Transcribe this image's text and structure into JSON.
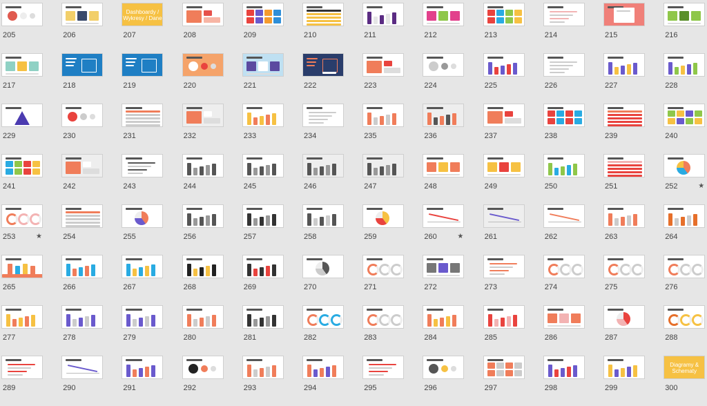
{
  "slides": [
    {
      "n": "205",
      "bg": "#ffffff",
      "accents": [
        "#e05a4f",
        "#ededed"
      ],
      "layout": "circles"
    },
    {
      "n": "206",
      "bg": "#ffffff",
      "accents": [
        "#f2cf6a",
        "#3a4a6b"
      ],
      "layout": "boxes"
    },
    {
      "n": "207",
      "bg": "#f6c143",
      "accents": [
        "#ffffff"
      ],
      "layout": "title",
      "text": "Dashboardy / Wykresy / Dane"
    },
    {
      "n": "208",
      "bg": "#ffffff",
      "accents": [
        "#f07d5a",
        "#e6514b",
        "#f7b5a5"
      ],
      "layout": "blocks"
    },
    {
      "n": "209",
      "bg": "#ffffff",
      "accents": [
        "#e9433e",
        "#6a5acd",
        "#f59b2f",
        "#2f8fd8"
      ],
      "layout": "mosaic"
    },
    {
      "n": "210",
      "bg": "#ffffff",
      "accents": [
        "#333333",
        "#f6c143"
      ],
      "layout": "table"
    },
    {
      "n": "211",
      "bg": "#ffffff",
      "accents": [
        "#5b2c83",
        "#e6e6e6"
      ],
      "layout": "bars"
    },
    {
      "n": "212",
      "bg": "#ffffff",
      "accents": [
        "#e2418c",
        "#8fc74a"
      ],
      "layout": "boxes"
    },
    {
      "n": "213",
      "bg": "#ffffff",
      "accents": [
        "#e9433e",
        "#29abe2",
        "#8fc74a",
        "#f6c143"
      ],
      "layout": "mosaic"
    },
    {
      "n": "214",
      "bg": "#ffffff",
      "accents": [
        "#f3b3b3",
        "#cccccc"
      ],
      "layout": "lines"
    },
    {
      "n": "215",
      "bg": "#f08079",
      "accents": [
        "#ffffff"
      ],
      "layout": "doc"
    },
    {
      "n": "216",
      "bg": "#ffffff",
      "accents": [
        "#8fc74a",
        "#5a8f2a"
      ],
      "layout": "boxes"
    },
    {
      "n": "217",
      "bg": "#ffffff",
      "accents": [
        "#8fd1c4",
        "#f6c143"
      ],
      "layout": "boxes"
    },
    {
      "n": "218",
      "bg": "#1f7fc4",
      "accents": [
        "#ffffff"
      ],
      "layout": "dark"
    },
    {
      "n": "219",
      "bg": "#1f7fc4",
      "accents": [
        "#ffffff"
      ],
      "layout": "dark"
    },
    {
      "n": "220",
      "bg": "#f5a36a",
      "accents": [
        "#ffffff",
        "#e9433e"
      ],
      "layout": "circles"
    },
    {
      "n": "221",
      "bg": "#bfe0f2",
      "accents": [
        "#5b4aa0",
        "#ffffff"
      ],
      "layout": "boxes"
    },
    {
      "n": "222",
      "bg": "#2a3d6b",
      "accents": [
        "#f07d5a",
        "#ffffff"
      ],
      "layout": "dark"
    },
    {
      "n": "223",
      "bg": "#ffffff",
      "accents": [
        "#f07d5a",
        "#e9433e"
      ],
      "layout": "blocks"
    },
    {
      "n": "224",
      "bg": "#ffffff",
      "accents": [
        "#cccccc",
        "#999999"
      ],
      "layout": "circles"
    },
    {
      "n": "225",
      "bg": "#ffffff",
      "accents": [
        "#6a5acd",
        "#e9433e"
      ],
      "layout": "bars"
    },
    {
      "n": "226",
      "bg": "#ffffff",
      "accents": [
        "#cccccc"
      ],
      "layout": "lines"
    },
    {
      "n": "227",
      "bg": "#ffffff",
      "accents": [
        "#6a5acd",
        "#f6c143"
      ],
      "layout": "bars"
    },
    {
      "n": "228",
      "bg": "#ffffff",
      "accents": [
        "#6a5acd",
        "#8fc74a",
        "#f6c143"
      ],
      "layout": "bars"
    },
    {
      "n": "229",
      "bg": "#ffffff",
      "accents": [
        "#4b3bb0",
        "#e9433e"
      ],
      "layout": "triangle"
    },
    {
      "n": "230",
      "bg": "#ffffff",
      "accents": [
        "#e9433e",
        "#cccccc"
      ],
      "layout": "circles"
    },
    {
      "n": "231",
      "bg": "#ffffff",
      "accents": [
        "#f07d5a",
        "#cccccc"
      ],
      "layout": "table"
    },
    {
      "n": "232",
      "bg": "#eeeeee",
      "accents": [
        "#f07d5a",
        "#ffffff"
      ],
      "layout": "blocks"
    },
    {
      "n": "233",
      "bg": "#ffffff",
      "accents": [
        "#f6c143",
        "#f07d5a"
      ],
      "layout": "bars"
    },
    {
      "n": "234",
      "bg": "#ffffff",
      "accents": [
        "#cccccc"
      ],
      "layout": "lines"
    },
    {
      "n": "235",
      "bg": "#ffffff",
      "accents": [
        "#f07d5a",
        "#cccccc"
      ],
      "layout": "bars"
    },
    {
      "n": "236",
      "bg": "#eeeeee",
      "accents": [
        "#f07d5a",
        "#555555"
      ],
      "layout": "bars"
    },
    {
      "n": "237",
      "bg": "#ffffff",
      "accents": [
        "#f07d5a",
        "#e9433e"
      ],
      "layout": "blocks"
    },
    {
      "n": "238",
      "bg": "#ffffff",
      "accents": [
        "#e9433e",
        "#29abe2"
      ],
      "layout": "mosaic"
    },
    {
      "n": "239",
      "bg": "#ffffff",
      "accents": [
        "#f07d5a",
        "#e9433e"
      ],
      "layout": "table"
    },
    {
      "n": "240",
      "bg": "#ffffff",
      "accents": [
        "#8fc74a",
        "#f6c143",
        "#6a5acd"
      ],
      "layout": "mosaic"
    },
    {
      "n": "241",
      "bg": "#ffffff",
      "accents": [
        "#29abe2",
        "#8fc74a",
        "#e9433e",
        "#f6c143"
      ],
      "layout": "mosaic"
    },
    {
      "n": "242",
      "bg": "#eeeeee",
      "accents": [
        "#f07d5a",
        "#ffffff"
      ],
      "layout": "blocks"
    },
    {
      "n": "243",
      "bg": "#ffffff",
      "accents": [
        "#555555",
        "#cccccc"
      ],
      "layout": "lines"
    },
    {
      "n": "244",
      "bg": "#ffffff",
      "accents": [
        "#555555",
        "#999999"
      ],
      "layout": "bars"
    },
    {
      "n": "245",
      "bg": "#ffffff",
      "accents": [
        "#555555",
        "#999999"
      ],
      "layout": "bars"
    },
    {
      "n": "246",
      "bg": "#eeeeee",
      "accents": [
        "#555555",
        "#999999"
      ],
      "layout": "bars"
    },
    {
      "n": "247",
      "bg": "#eeeeee",
      "accents": [
        "#555555",
        "#999999"
      ],
      "layout": "bars"
    },
    {
      "n": "248",
      "bg": "#ffffff",
      "accents": [
        "#f07d5a",
        "#f6c143"
      ],
      "layout": "boxes"
    },
    {
      "n": "249",
      "bg": "#ffffff",
      "accents": [
        "#f6c143",
        "#e9433e"
      ],
      "layout": "boxes"
    },
    {
      "n": "250",
      "bg": "#ffffff",
      "accents": [
        "#8fc74a",
        "#29abe2"
      ],
      "layout": "bars"
    },
    {
      "n": "251",
      "bg": "#ffffff",
      "accents": [
        "#f3b3b3",
        "#e9433e"
      ],
      "layout": "table"
    },
    {
      "n": "252",
      "bg": "#ffffff",
      "accents": [
        "#f07d5a",
        "#29abe2",
        "#f6c143"
      ],
      "layout": "pie",
      "star": true
    },
    {
      "n": "253",
      "bg": "#ffffff",
      "accents": [
        "#f07d5a",
        "#f3b3b3"
      ],
      "layout": "donut",
      "star": true
    },
    {
      "n": "254",
      "bg": "#ffffff",
      "accents": [
        "#f07d5a",
        "#cccccc"
      ],
      "layout": "table"
    },
    {
      "n": "255",
      "bg": "#ffffff",
      "accents": [
        "#f07d5a",
        "#6a5acd"
      ],
      "layout": "pie"
    },
    {
      "n": "256",
      "bg": "#ffffff",
      "accents": [
        "#555555",
        "#999999"
      ],
      "layout": "bars"
    },
    {
      "n": "257",
      "bg": "#ffffff",
      "accents": [
        "#333333",
        "#999999"
      ],
      "layout": "bars"
    },
    {
      "n": "258",
      "bg": "#ffffff",
      "accents": [
        "#555555",
        "#cccccc"
      ],
      "layout": "bars"
    },
    {
      "n": "259",
      "bg": "#ffffff",
      "accents": [
        "#f6c143",
        "#e9433e"
      ],
      "layout": "pie"
    },
    {
      "n": "260",
      "bg": "#ffffff",
      "accents": [
        "#e9433e",
        "#cccccc"
      ],
      "layout": "line",
      "star": true
    },
    {
      "n": "261",
      "bg": "#eeeeee",
      "accents": [
        "#6a5acd",
        "#cccccc"
      ],
      "layout": "line"
    },
    {
      "n": "262",
      "bg": "#ffffff",
      "accents": [
        "#f07d5a",
        "#cccccc"
      ],
      "layout": "line"
    },
    {
      "n": "263",
      "bg": "#ffffff",
      "accents": [
        "#f07d5a",
        "#cccccc"
      ],
      "layout": "bars"
    },
    {
      "n": "264",
      "bg": "#ffffff",
      "accents": [
        "#e66f2a",
        "#cccccc"
      ],
      "layout": "bars"
    },
    {
      "n": "265",
      "bg": "#ffffff",
      "accents": [
        "#f07d5a",
        "#29abe2",
        "#f6c143"
      ],
      "layout": "arrows"
    },
    {
      "n": "266",
      "bg": "#ffffff",
      "accents": [
        "#29abe2",
        "#f07d5a"
      ],
      "layout": "bars"
    },
    {
      "n": "267",
      "bg": "#ffffff",
      "accents": [
        "#29abe2",
        "#f6c143"
      ],
      "layout": "bars"
    },
    {
      "n": "268",
      "bg": "#ffffff",
      "accents": [
        "#222222",
        "#f6c143"
      ],
      "layout": "bars"
    },
    {
      "n": "269",
      "bg": "#ffffff",
      "accents": [
        "#333333",
        "#e9433e"
      ],
      "layout": "bars"
    },
    {
      "n": "270",
      "bg": "#ffffff",
      "accents": [
        "#555555",
        "#cccccc"
      ],
      "layout": "pie"
    },
    {
      "n": "271",
      "bg": "#ffffff",
      "accents": [
        "#f07d5a",
        "#cccccc"
      ],
      "layout": "donut"
    },
    {
      "n": "272",
      "bg": "#ffffff",
      "accents": [
        "#777777",
        "#6a5acd"
      ],
      "layout": "boxes"
    },
    {
      "n": "273",
      "bg": "#ffffff",
      "accents": [
        "#f07d5a",
        "#cccccc"
      ],
      "layout": "lines"
    },
    {
      "n": "274",
      "bg": "#ffffff",
      "accents": [
        "#f07d5a",
        "#cccccc"
      ],
      "layout": "donut"
    },
    {
      "n": "275",
      "bg": "#ffffff",
      "accents": [
        "#f07d5a",
        "#cccccc"
      ],
      "layout": "donut"
    },
    {
      "n": "276",
      "bg": "#ffffff",
      "accents": [
        "#f07d5a",
        "#cccccc"
      ],
      "layout": "donut"
    },
    {
      "n": "277",
      "bg": "#ffffff",
      "accents": [
        "#f6c143",
        "#f07d5a"
      ],
      "layout": "bars"
    },
    {
      "n": "278",
      "bg": "#ffffff",
      "accents": [
        "#6a5acd",
        "#cccccc"
      ],
      "layout": "bars"
    },
    {
      "n": "279",
      "bg": "#ffffff",
      "accents": [
        "#6a5acd",
        "#cccccc"
      ],
      "layout": "bars"
    },
    {
      "n": "280",
      "bg": "#ffffff",
      "accents": [
        "#f07d5a",
        "#cccccc"
      ],
      "layout": "bars"
    },
    {
      "n": "281",
      "bg": "#ffffff",
      "accents": [
        "#333333",
        "#999999"
      ],
      "layout": "bars"
    },
    {
      "n": "282",
      "bg": "#ffffff",
      "accents": [
        "#f07d5a",
        "#29abe2"
      ],
      "layout": "donut"
    },
    {
      "n": "283",
      "bg": "#ffffff",
      "accents": [
        "#f07d5a",
        "#cccccc"
      ],
      "layout": "donut"
    },
    {
      "n": "284",
      "bg": "#ffffff",
      "accents": [
        "#f07d5a",
        "#f6c143"
      ],
      "layout": "bars"
    },
    {
      "n": "285",
      "bg": "#ffffff",
      "accents": [
        "#e9433e",
        "#f3b3b3"
      ],
      "layout": "bars"
    },
    {
      "n": "286",
      "bg": "#ffffff",
      "accents": [
        "#f07d5a",
        "#f3b3b3"
      ],
      "layout": "boxes"
    },
    {
      "n": "287",
      "bg": "#ffffff",
      "accents": [
        "#e9433e",
        "#f3b3b3"
      ],
      "layout": "pie"
    },
    {
      "n": "288",
      "bg": "#ffffff",
      "accents": [
        "#e66f2a",
        "#f6c143"
      ],
      "layout": "donut"
    },
    {
      "n": "289",
      "bg": "#ffffff",
      "accents": [
        "#e9433e",
        "#cccccc"
      ],
      "layout": "lines"
    },
    {
      "n": "290",
      "bg": "#ffffff",
      "accents": [
        "#6a5acd",
        "#cccccc"
      ],
      "layout": "line"
    },
    {
      "n": "291",
      "bg": "#ffffff",
      "accents": [
        "#6a5acd",
        "#f07d5a"
      ],
      "layout": "bars"
    },
    {
      "n": "292",
      "bg": "#ffffff",
      "accents": [
        "#222222",
        "#f07d5a"
      ],
      "layout": "circles"
    },
    {
      "n": "293",
      "bg": "#ffffff",
      "accents": [
        "#f07d5a",
        "#cccccc"
      ],
      "layout": "bars"
    },
    {
      "n": "294",
      "bg": "#ffffff",
      "accents": [
        "#f07d5a",
        "#6a5acd"
      ],
      "layout": "bars"
    },
    {
      "n": "295",
      "bg": "#ffffff",
      "accents": [
        "#e9433e",
        "#cccccc"
      ],
      "layout": "lines"
    },
    {
      "n": "296",
      "bg": "#ffffff",
      "accents": [
        "#555555",
        "#f6c143"
      ],
      "layout": "circles"
    },
    {
      "n": "297",
      "bg": "#ffffff",
      "accents": [
        "#f07d5a",
        "#cccccc"
      ],
      "layout": "mosaic"
    },
    {
      "n": "298",
      "bg": "#ffffff",
      "accents": [
        "#6a5acd",
        "#e9433e"
      ],
      "layout": "bars"
    },
    {
      "n": "299",
      "bg": "#ffffff",
      "accents": [
        "#f6c143",
        "#6a5acd"
      ],
      "layout": "bars"
    },
    {
      "n": "300",
      "bg": "#f6c143",
      "accents": [
        "#ffffff"
      ],
      "layout": "title",
      "text": "Diagramy & Schematy"
    }
  ]
}
